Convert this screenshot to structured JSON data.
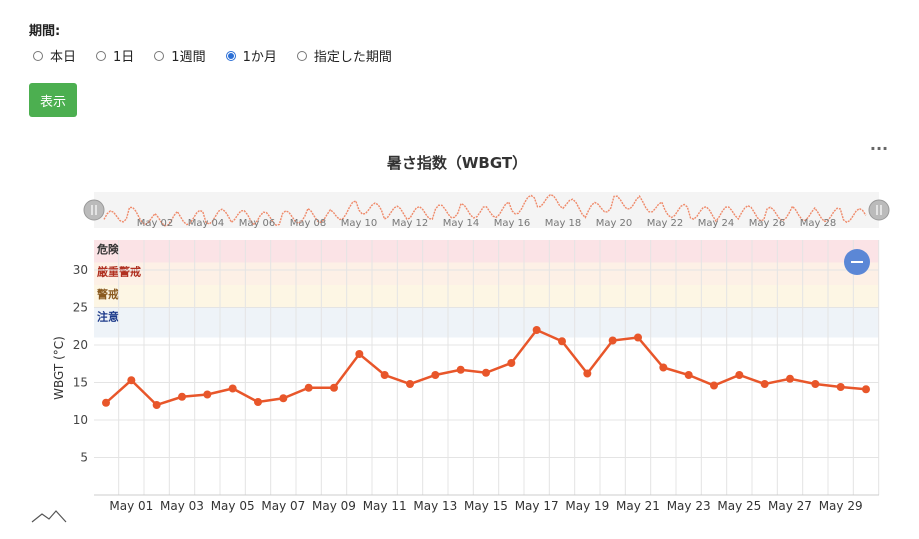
{
  "form": {
    "period_label": "期間:",
    "options": [
      "本日",
      "1日",
      "1週間",
      "1か月",
      "指定した期間"
    ],
    "selected_index": 3,
    "submit_label": "表示",
    "submit_color": "#4caf50"
  },
  "chart_menu": {
    "label": "..."
  },
  "chart_data": {
    "type": "line",
    "title": "暑さ指数（WBGT）",
    "ylabel": "WBGT (°C)",
    "ylim": [
      0,
      34
    ],
    "yticks": [
      5,
      10,
      15,
      20,
      25,
      30
    ],
    "series_color": "#e8562a",
    "x": [
      "Apr 30",
      "May 01",
      "May 02",
      "May 03",
      "May 04",
      "May 05",
      "May 06",
      "May 07",
      "May 08",
      "May 09",
      "May 10",
      "May 11",
      "May 12",
      "May 13",
      "May 14",
      "May 15",
      "May 16",
      "May 17",
      "May 18",
      "May 19",
      "May 20",
      "May 21",
      "May 22",
      "May 23",
      "May 24",
      "May 25",
      "May 26",
      "May 27",
      "May 28",
      "May 29",
      "May 30"
    ],
    "values": [
      12.3,
      15.3,
      12.0,
      13.1,
      13.4,
      14.2,
      12.4,
      12.9,
      14.3,
      14.3,
      18.8,
      16.0,
      14.8,
      16.0,
      16.7,
      16.3,
      17.6,
      22.0,
      20.5,
      16.2,
      20.6,
      21.0,
      17.0,
      16.0,
      14.6,
      16.0,
      14.8,
      15.5,
      14.8,
      14.4,
      14.1
    ],
    "x_tick_labels": [
      "May 01",
      "May 03",
      "May 05",
      "May 07",
      "May 09",
      "May 11",
      "May 13",
      "May 15",
      "May 17",
      "May 19",
      "May 21",
      "May 23",
      "May 25",
      "May 27",
      "May 29"
    ],
    "bands": [
      {
        "label": "危険",
        "from": 31,
        "to": 34,
        "fill": "#fbe3e6",
        "text_color": "#333333"
      },
      {
        "label": "厳重警戒",
        "from": 28,
        "to": 31,
        "fill": "#fdf0e6",
        "text_color": "#b03020"
      },
      {
        "label": "警戒",
        "from": 25,
        "to": 28,
        "fill": "#fdf6e4",
        "text_color": "#8a5a20"
      },
      {
        "label": "注意",
        "from": 21,
        "to": 25,
        "fill": "#eef3f8",
        "text_color": "#1d3a8a"
      }
    ],
    "navigator_labels": [
      "May 02",
      "May 04",
      "May 06",
      "May 08",
      "May 10",
      "May 12",
      "May 14",
      "May 16",
      "May 18",
      "May 20",
      "May 22",
      "May 24",
      "May 26",
      "May 28"
    ],
    "grid": true
  }
}
